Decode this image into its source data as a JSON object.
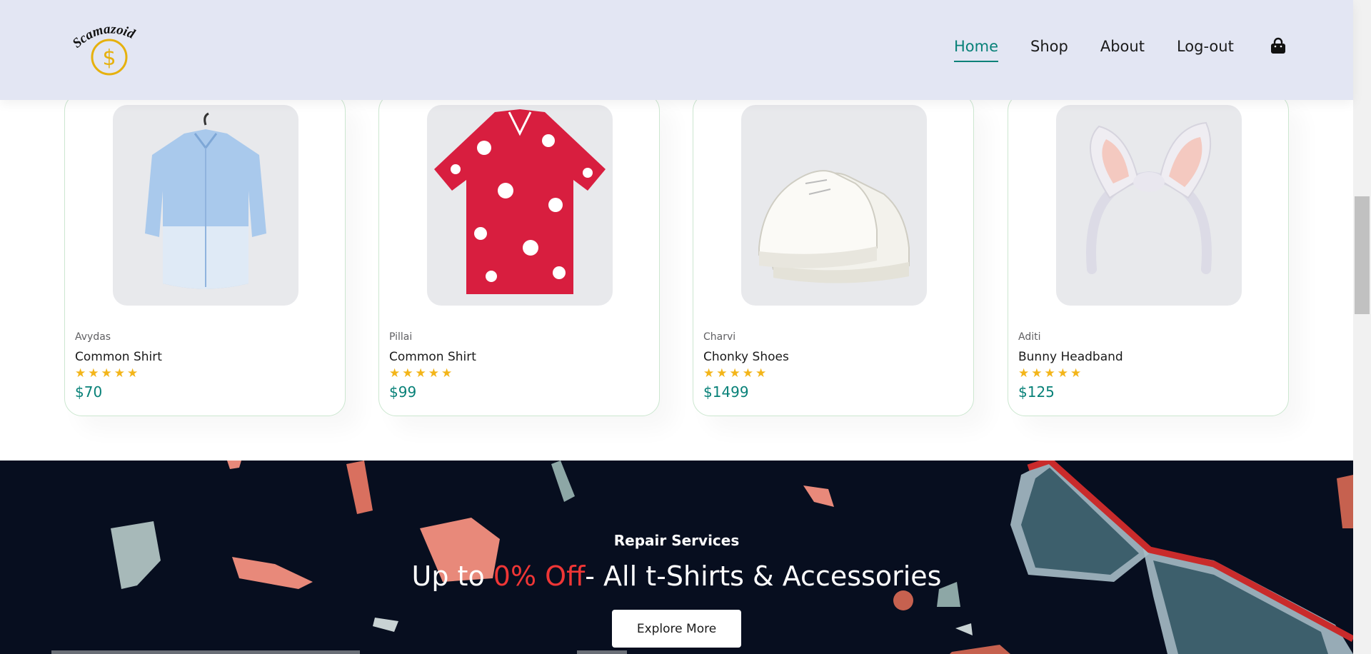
{
  "header": {
    "logo_text": "Scamazoid",
    "logo_symbol": "$",
    "nav": [
      {
        "label": "Home",
        "active": true
      },
      {
        "label": "Shop",
        "active": false
      },
      {
        "label": "About",
        "active": false
      },
      {
        "label": "Log-out",
        "active": false
      }
    ],
    "cart_icon": "shopping-bag-icon"
  },
  "products": [
    {
      "brand": "Avydas",
      "name": "Common Shirt",
      "stars": "★★★★★",
      "rating": 5,
      "price": "$70",
      "image": "light-blue-shirt"
    },
    {
      "brand": "Pillai",
      "name": "Common Shirt",
      "stars": "★★★★★",
      "rating": 5,
      "price": "$99",
      "image": "red-hawaiian-shirt"
    },
    {
      "brand": "Charvi",
      "name": "Chonky Shoes",
      "stars": "★★★★★",
      "rating": 5,
      "price": "$1499",
      "image": "white-chunky-sneakers"
    },
    {
      "brand": "Aditi",
      "name": "Bunny Headband",
      "stars": "★★★★★",
      "rating": 5,
      "price": "$125",
      "image": "bunny-ear-headband"
    }
  ],
  "banner": {
    "subtitle": "Repair Services",
    "title_prefix": "Up to ",
    "title_highlight": "0% Off",
    "title_suffix": "- All t-Shirts & Accessories",
    "button_label": "Explore More"
  },
  "colors": {
    "accent": "#088178",
    "header_bg": "#e3e6f3",
    "banner_bg": "#070e1f",
    "highlight": "#ef3636",
    "star": "#f3b519"
  }
}
